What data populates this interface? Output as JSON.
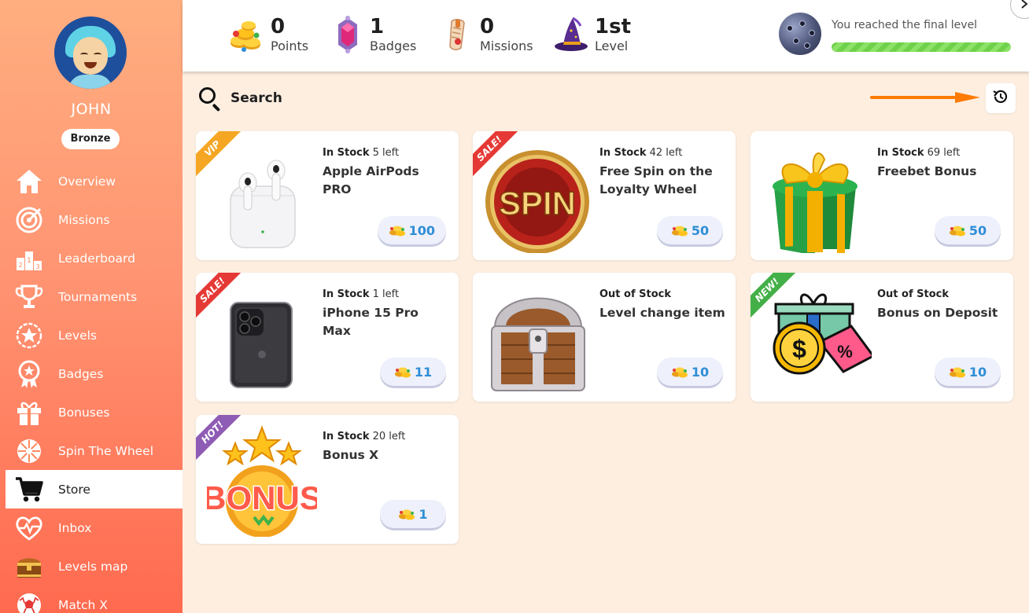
{
  "user": {
    "name": "JOHN",
    "tier": "Bronze"
  },
  "nav": [
    {
      "label": "Overview",
      "icon": "home-icon"
    },
    {
      "label": "Missions",
      "icon": "target-icon"
    },
    {
      "label": "Leaderboard",
      "icon": "podium-icon"
    },
    {
      "label": "Tournaments",
      "icon": "trophy-icon"
    },
    {
      "label": "Levels",
      "icon": "star-badge-icon"
    },
    {
      "label": "Badges",
      "icon": "medal-icon"
    },
    {
      "label": "Bonuses",
      "icon": "gift-icon"
    },
    {
      "label": "Spin The Wheel",
      "icon": "wheel-icon"
    },
    {
      "label": "Store",
      "icon": "cart-icon",
      "active": true
    },
    {
      "label": "Inbox",
      "icon": "heart-pulse-icon"
    },
    {
      "label": "Levels map",
      "icon": "chest-icon"
    },
    {
      "label": "Match X",
      "icon": "soccer-ball-icon"
    }
  ],
  "stats": {
    "points": {
      "value": "0",
      "label": "Points"
    },
    "badges": {
      "value": "1",
      "label": "Badges"
    },
    "missions": {
      "value": "0",
      "label": "Missions"
    },
    "level": {
      "value": "1st",
      "label": "Level"
    }
  },
  "progress": {
    "text": "You reached the final level",
    "fraction": 1.0
  },
  "search": {
    "label": "Search"
  },
  "colors": {
    "accent": "#ff7a00",
    "price_text": "#2f8ed6",
    "sidebar_top": "#ffae80",
    "sidebar_bottom": "#ff6a4f"
  },
  "items": [
    {
      "stock_status": "In Stock",
      "stock_left": "5 left",
      "title": "Apple AirPods PRO",
      "price": "100",
      "ribbon": "VIP",
      "ribbon_color": "#f5a623",
      "image": "airpods"
    },
    {
      "stock_status": "In Stock",
      "stock_left": "42 left",
      "title": "Free Spin on the Loyalty Wheel",
      "price": "50",
      "ribbon": "SALE!",
      "ribbon_color": "#e53935",
      "image": "spin",
      "image_text": "SPIN"
    },
    {
      "stock_status": "In Stock",
      "stock_left": "69 left",
      "title": "Freebet Bonus",
      "price": "50",
      "ribbon": "",
      "image": "gift-box"
    },
    {
      "stock_status": "In Stock",
      "stock_left": "1 left",
      "title": "iPhone 15 Pro Max",
      "price": "11",
      "ribbon": "SALE!",
      "ribbon_color": "#e53935",
      "image": "iphone"
    },
    {
      "stock_status": "Out of Stock",
      "stock_left": "",
      "title": "Level change item",
      "price": "10",
      "ribbon": "",
      "image": "chest"
    },
    {
      "stock_status": "Out of Stock",
      "stock_left": "",
      "title": "Bonus on Deposit",
      "price": "10",
      "ribbon": "NEW!",
      "ribbon_color": "#43b047",
      "image": "deposit"
    },
    {
      "stock_status": "In Stock",
      "stock_left": "20 left",
      "title": "Bonus X",
      "price": "1",
      "ribbon": "HOT!",
      "ribbon_color": "#8e5bb5",
      "image": "bonus",
      "image_text": "BONUS"
    }
  ]
}
